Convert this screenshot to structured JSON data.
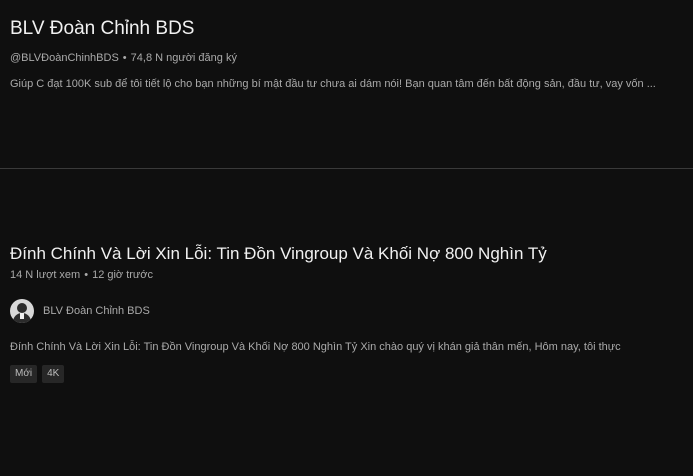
{
  "channel": {
    "title": "BLV Đoàn Chỉnh BDS",
    "handle": "@BLVĐoànChinhBDS",
    "separator": "•",
    "subscribers": "74,8 N người đăng ký",
    "description": "Giúp C đạt 100K sub để tôi tiết lộ cho bạn những bí mật đầu tư chưa ai dám nói! Bạn quan tâm đến bất động sản, đầu tư, vay vốn ..."
  },
  "video": {
    "title": "Đính Chính Và Lời Xin Lỗi: Tin Đồn Vingroup Và Khối Nợ 800 Nghìn Tỷ",
    "views": "14 N lượt xem",
    "separator": "•",
    "published": "12 giờ trước",
    "channel_name": "BLV Đoàn Chỉnh BDS",
    "description": "Đính Chính Và Lời Xin Lỗi: Tin Đồn Vingroup Và Khối Nợ 800 Nghìn Tỷ Xin chào quý vị khán giả thân mến, Hôm nay, tôi thực",
    "badges": [
      "Mới",
      "4K"
    ],
    "avatar_icon": "person-avatar-icon"
  },
  "colors": {
    "background": "#0f0f0f",
    "primary_text": "#f1f1f1",
    "secondary_text": "#aaaaaa",
    "badge_background": "#272727",
    "separator": "#3a3a3a"
  }
}
